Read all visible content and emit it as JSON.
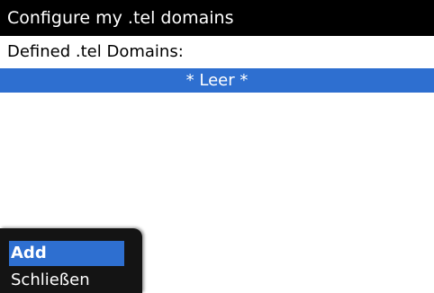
{
  "header": {
    "title": "Configure my .tel domains"
  },
  "main": {
    "section_label": "Defined .tel Domains:",
    "list_items": [
      {
        "label": "* Leer *",
        "selected": true
      }
    ]
  },
  "menu": {
    "items": [
      {
        "label": "Add",
        "selected": true
      },
      {
        "label": "Schließen",
        "selected": false
      }
    ]
  },
  "colors": {
    "title_bar": "#000000",
    "selection": "#2e6fd0",
    "menu_background": "#141414"
  }
}
